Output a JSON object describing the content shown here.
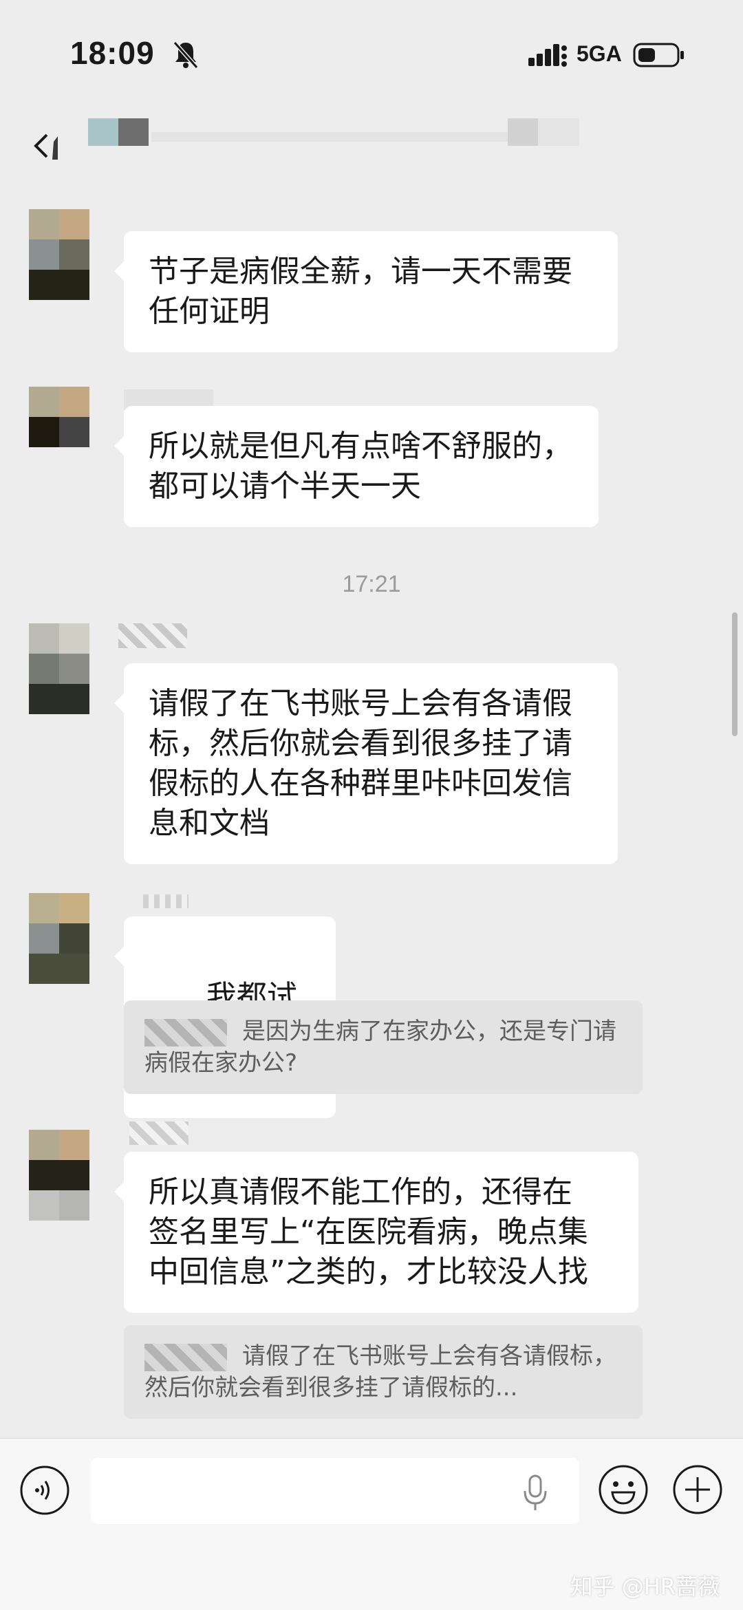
{
  "status_bar": {
    "time": "18:09",
    "network": "5GA"
  },
  "nav": {
    "title_redacted": true
  },
  "messages": [
    {
      "text": "节子是病假全薪，请一天不需要\n任何证明"
    },
    {
      "text": "所以就是但凡有点啥不舒服的，\n都可以请个半天一天"
    },
    {
      "text": "请假了在飞书账号上会有各请假\n标，然后你就会看到很多挂了请\n假标的人在各种群里咔咔回发信\n息和文档"
    },
    {
      "text": "我都试过"
    },
    {
      "text": "所以真请假不能工作的，还得在\n签名里写上“在医院看病，晚点集\n中回信息”之类的，才比较没人找"
    }
  ],
  "timestamp": "17:21",
  "quotes": [
    {
      "text": "是因为生病了在家办公，还是专门请病假在家办公?"
    },
    {
      "text": "请假了在飞书账号上会有各请假标，然后你就会看到很多挂了请假标的..."
    }
  ],
  "input_bar": {
    "placeholder": ""
  },
  "watermark": "知乎 @HR蔷薇",
  "colors": {
    "background": "#ededed",
    "bubble": "#ffffff",
    "quote": "#e3e3e3",
    "timestamp": "#9b9b9b"
  }
}
